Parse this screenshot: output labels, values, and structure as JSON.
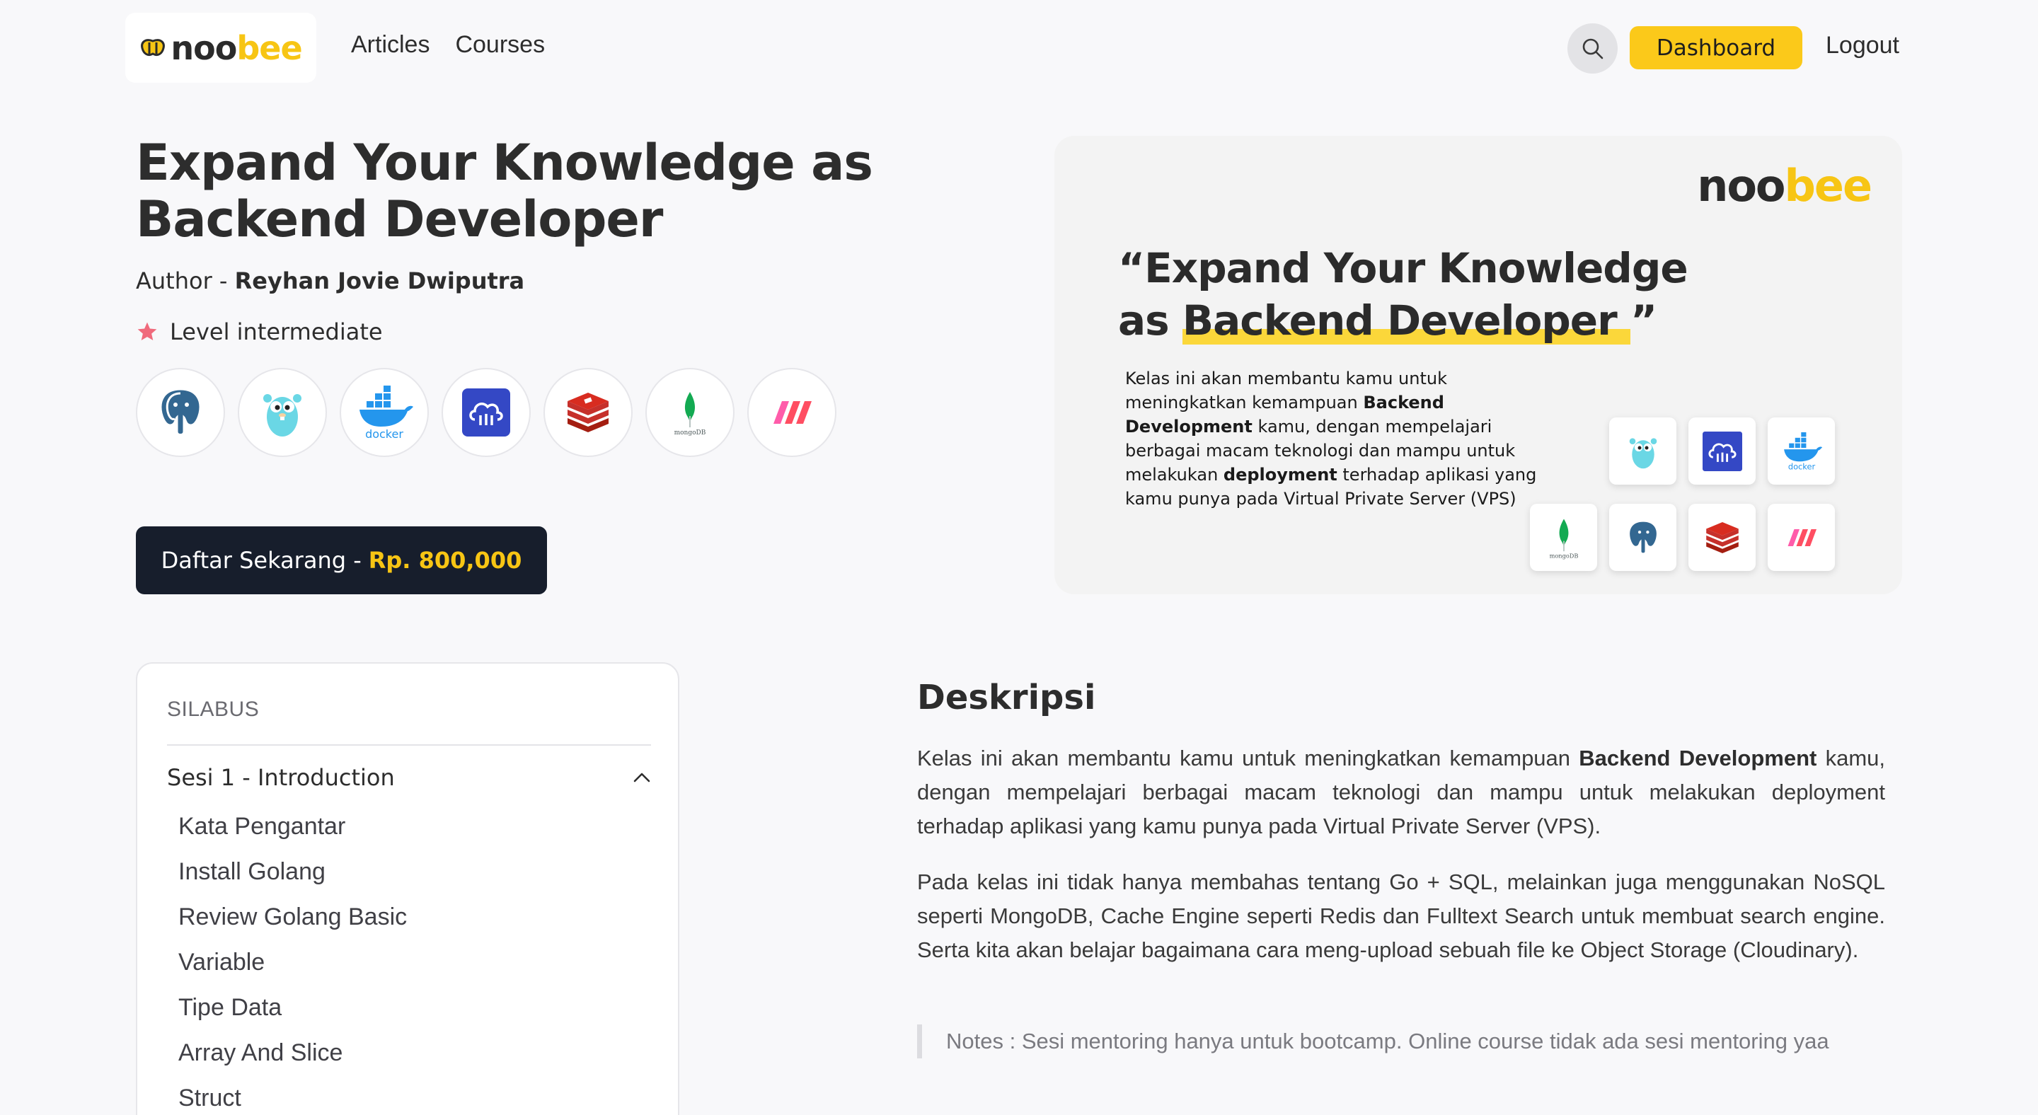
{
  "header": {
    "logo": {
      "part1": "noo",
      "part2": "bee"
    },
    "nav": [
      "Articles",
      "Courses"
    ],
    "dashboard_label": "Dashboard",
    "logout_label": "Logout",
    "search_icon": "search-icon"
  },
  "course": {
    "title": "Expand Your Knowledge as Backend Developer",
    "author_prefix": "Author - ",
    "author_name": "Reyhan Jovie Dwiputra",
    "level": "Level intermediate",
    "level_icon": "star-icon",
    "tech_stack": [
      "postgresql-icon",
      "golang-gopher-icon",
      "docker-icon",
      "cloudinary-icon",
      "redis-icon",
      "mongodb-icon",
      "meilisearch-icon"
    ],
    "cta_prefix": "Daftar Sekarang - ",
    "cta_price": "Rp. 800,000"
  },
  "banner": {
    "logo": {
      "part1": "noo",
      "part2": "bee"
    },
    "quote_line1": "“Expand Your Knowledge",
    "quote_as": "as ",
    "quote_highlight": "Backend Developer ",
    "quote_close": "”",
    "desc_1": "Kelas ini akan membantu kamu untuk meningkatkan kemampuan ",
    "desc_bold1": "Backend Development",
    "desc_2": "  kamu, dengan mempelajari berbagai macam teknologi dan mampu untuk melakukan ",
    "desc_bold2": "deployment",
    "desc_3": " terhadap aplikasi yang kamu punya pada Virtual Private Server (VPS)"
  },
  "syllabus": {
    "heading": "SILABUS",
    "session_title": "Sesi 1 - Introduction",
    "lessons": [
      "Kata Pengantar",
      "Install Golang",
      "Review Golang Basic",
      "Variable",
      "Tipe Data",
      "Array And Slice",
      "Struct"
    ]
  },
  "description": {
    "title": "Deskripsi",
    "p1_a": "Kelas ini akan membantu kamu untuk meningkatkan kemampuan ",
    "p1_bold": "Backend Development",
    "p1_b": " kamu, dengan mempelajari berbagai macam teknologi dan mampu untuk melakukan deployment terhadap aplikasi yang kamu punya pada Virtual Private Server (VPS).",
    "p2": "Pada kelas ini tidak hanya membahas tentang Go + SQL, melainkan juga menggunakan NoSQL seperti MongoDB, Cache Engine seperti Redis dan Fulltext Search untuk membuat search engine. Serta kita akan belajar bagaimana cara meng-upload sebuah file ke Object Storage (Cloudinary).",
    "note": "Notes : Sesi mentoring hanya untuk bootcamp. Online course tidak ada sesi mentoring yaa"
  },
  "colors": {
    "accent": "#fbc91a",
    "dark": "#171e2c",
    "star": "#f06a7c",
    "text": "#2d2d2d"
  }
}
